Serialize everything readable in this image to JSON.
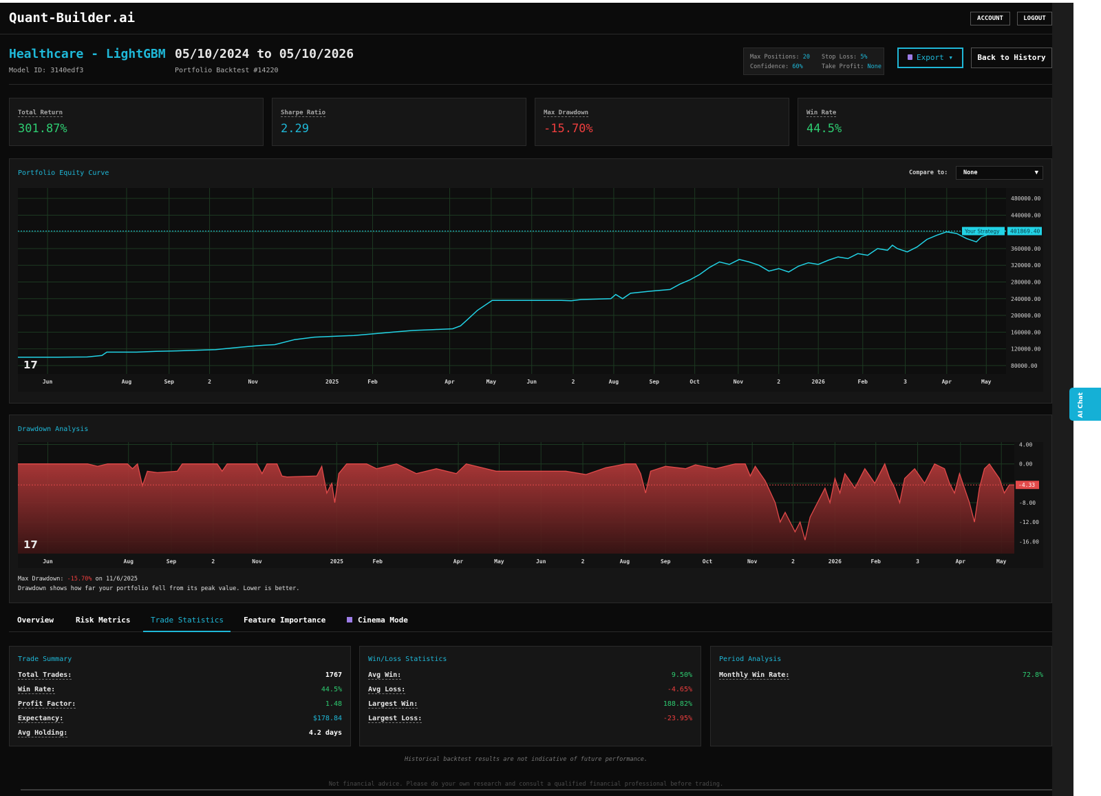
{
  "app": {
    "brand": "Quant-Builder.ai",
    "account_label": "ACCOUNT",
    "logout_label": "LOGOUT",
    "ai_chat_label": "AI Chat"
  },
  "header": {
    "title": "Healthcare - LightGBM",
    "model_id": "Model ID: 3140edf3",
    "date_range": "05/10/2024 to 05/10/2026",
    "backtest": "Portfolio Backtest #14220",
    "settings": {
      "max_positions_label": "Max Positions:",
      "max_positions_value": "20",
      "stop_loss_label": "Stop Loss:",
      "stop_loss_value": "5%",
      "confidence_label": "Confidence:",
      "confidence_value": "60%",
      "take_profit_label": "Take Profit:",
      "take_profit_value": "None"
    },
    "export_label": "Export ▾",
    "back_label": "Back to History"
  },
  "metrics": [
    {
      "label": "Total Return",
      "value": "301.87%",
      "color": "#2ecc71"
    },
    {
      "label": "Sharpe Ratio",
      "value": "2.29",
      "color": "#1fb8d8"
    },
    {
      "label": "Max Drawdown",
      "value": "-15.70%",
      "color": "#ef3e3e"
    },
    {
      "label": "Win Rate",
      "value": "44.5%",
      "color": "#2ecc71"
    }
  ],
  "equity_panel": {
    "title": "Portfolio Equity Curve",
    "compare_label": "Compare to:",
    "compare_value": "None",
    "logo": "17"
  },
  "drawdown_panel": {
    "title": "Drawdown Analysis",
    "max_label": "Max Drawdown:",
    "max_value": "-15.70%",
    "max_date": "on 11/6/2025",
    "note": "Drawdown shows how far your portfolio fell from its peak value. Lower is better.",
    "logo": "17"
  },
  "chart_data": [
    {
      "type": "line",
      "title": "Portfolio Equity Curve",
      "series": [
        {
          "name": "Your Strategy"
        }
      ],
      "y_ticks": [
        "480000.00",
        "440000.00",
        "400000.00",
        "360000.00",
        "320000.00",
        "280000.00",
        "240000.00",
        "200000.00",
        "160000.00",
        "120000.00",
        "80000.00"
      ],
      "ylim": [
        60000,
        505000
      ],
      "last_value": 401869.4,
      "last_value_label": "401869.40",
      "series_label": "Your Strategy",
      "x_ticks": [
        {
          "label": "Jun",
          "t": 0.03
        },
        {
          "label": "Aug",
          "t": 0.11
        },
        {
          "label": "Sep",
          "t": 0.153
        },
        {
          "label": "2",
          "t": 0.194
        },
        {
          "label": "Nov",
          "t": 0.238
        },
        {
          "label": "2025",
          "t": 0.318
        },
        {
          "label": "Feb",
          "t": 0.359
        },
        {
          "label": "Apr",
          "t": 0.437
        },
        {
          "label": "May",
          "t": 0.479
        },
        {
          "label": "Jun",
          "t": 0.52
        },
        {
          "label": "2",
          "t": 0.562
        },
        {
          "label": "Aug",
          "t": 0.603
        },
        {
          "label": "Sep",
          "t": 0.644
        },
        {
          "label": "Oct",
          "t": 0.685
        },
        {
          "label": "Nov",
          "t": 0.729
        },
        {
          "label": "2",
          "t": 0.77
        },
        {
          "label": "2026",
          "t": 0.81
        },
        {
          "label": "Feb",
          "t": 0.855
        },
        {
          "label": "3",
          "t": 0.898
        },
        {
          "label": "Apr",
          "t": 0.94
        },
        {
          "label": "May",
          "t": 0.98
        }
      ],
      "points": [
        [
          0.0,
          100000
        ],
        [
          0.04,
          100000
        ],
        [
          0.07,
          100500
        ],
        [
          0.085,
          104000
        ],
        [
          0.09,
          112000
        ],
        [
          0.12,
          112000
        ],
        [
          0.14,
          114000
        ],
        [
          0.16,
          115000
        ],
        [
          0.2,
          118000
        ],
        [
          0.225,
          124000
        ],
        [
          0.245,
          128000
        ],
        [
          0.26,
          130000
        ],
        [
          0.28,
          142000
        ],
        [
          0.3,
          148000
        ],
        [
          0.32,
          150000
        ],
        [
          0.34,
          152000
        ],
        [
          0.36,
          156000
        ],
        [
          0.38,
          160000
        ],
        [
          0.4,
          164000
        ],
        [
          0.42,
          166000
        ],
        [
          0.44,
          168000
        ],
        [
          0.448,
          175000
        ],
        [
          0.455,
          190000
        ],
        [
          0.465,
          212000
        ],
        [
          0.48,
          236000
        ],
        [
          0.55,
          236000
        ],
        [
          0.56,
          235000
        ],
        [
          0.57,
          238000
        ],
        [
          0.6,
          240000
        ],
        [
          0.605,
          250000
        ],
        [
          0.612,
          240000
        ],
        [
          0.62,
          253000
        ],
        [
          0.64,
          258000
        ],
        [
          0.66,
          262000
        ],
        [
          0.67,
          275000
        ],
        [
          0.68,
          285000
        ],
        [
          0.69,
          298000
        ],
        [
          0.7,
          315000
        ],
        [
          0.71,
          328000
        ],
        [
          0.72,
          322000
        ],
        [
          0.73,
          334000
        ],
        [
          0.74,
          328000
        ],
        [
          0.75,
          320000
        ],
        [
          0.76,
          306000
        ],
        [
          0.77,
          312000
        ],
        [
          0.78,
          304000
        ],
        [
          0.79,
          318000
        ],
        [
          0.8,
          326000
        ],
        [
          0.81,
          322000
        ],
        [
          0.82,
          332000
        ],
        [
          0.83,
          340000
        ],
        [
          0.84,
          336000
        ],
        [
          0.85,
          348000
        ],
        [
          0.86,
          344000
        ],
        [
          0.87,
          360000
        ],
        [
          0.88,
          356000
        ],
        [
          0.885,
          368000
        ],
        [
          0.89,
          360000
        ],
        [
          0.9,
          352000
        ],
        [
          0.91,
          364000
        ],
        [
          0.92,
          382000
        ],
        [
          0.93,
          392000
        ],
        [
          0.94,
          400000
        ],
        [
          0.95,
          396000
        ],
        [
          0.96,
          384000
        ],
        [
          0.97,
          376000
        ],
        [
          0.975,
          388000
        ],
        [
          0.98,
          392000
        ],
        [
          0.99,
          404000
        ],
        [
          1.0,
          401869
        ]
      ]
    },
    {
      "type": "area",
      "title": "Drawdown Analysis",
      "y_ticks": [
        "4.00",
        "0.00",
        "-4.00",
        "-8.00",
        "-12.00",
        "-16.00"
      ],
      "ylim": [
        -18.5,
        4.5
      ],
      "last_value": -4.33,
      "last_value_label": "-4.33",
      "x_ticks": [
        {
          "label": "Jun",
          "t": 0.03
        },
        {
          "label": "Aug",
          "t": 0.111
        },
        {
          "label": "Sep",
          "t": 0.154
        },
        {
          "label": "2",
          "t": 0.196
        },
        {
          "label": "Nov",
          "t": 0.24
        },
        {
          "label": "2025",
          "t": 0.32
        },
        {
          "label": "Feb",
          "t": 0.361
        },
        {
          "label": "Apr",
          "t": 0.442
        },
        {
          "label": "May",
          "t": 0.483
        },
        {
          "label": "Jun",
          "t": 0.525
        },
        {
          "label": "2",
          "t": 0.567
        },
        {
          "label": "Aug",
          "t": 0.609
        },
        {
          "label": "Sep",
          "t": 0.65
        },
        {
          "label": "Oct",
          "t": 0.692
        },
        {
          "label": "Nov",
          "t": 0.737
        },
        {
          "label": "2",
          "t": 0.778
        },
        {
          "label": "2026",
          "t": 0.82
        },
        {
          "label": "Feb",
          "t": 0.861
        },
        {
          "label": "3",
          "t": 0.903
        },
        {
          "label": "Apr",
          "t": 0.946
        },
        {
          "label": "May",
          "t": 0.987
        }
      ],
      "points": [
        [
          0.0,
          0
        ],
        [
          0.07,
          0
        ],
        [
          0.08,
          -0.5
        ],
        [
          0.09,
          0
        ],
        [
          0.11,
          0
        ],
        [
          0.115,
          -1
        ],
        [
          0.12,
          0
        ],
        [
          0.125,
          -4.5
        ],
        [
          0.13,
          -1.5
        ],
        [
          0.14,
          -1.8
        ],
        [
          0.16,
          -1.5
        ],
        [
          0.165,
          0
        ],
        [
          0.2,
          0
        ],
        [
          0.205,
          -1.5
        ],
        [
          0.21,
          0
        ],
        [
          0.24,
          0
        ],
        [
          0.245,
          -2
        ],
        [
          0.25,
          0
        ],
        [
          0.26,
          0
        ],
        [
          0.265,
          -2.5
        ],
        [
          0.27,
          -2.7
        ],
        [
          0.3,
          -2.5
        ],
        [
          0.305,
          -0.5
        ],
        [
          0.31,
          -6
        ],
        [
          0.315,
          -4
        ],
        [
          0.318,
          -8
        ],
        [
          0.322,
          -2
        ],
        [
          0.33,
          0
        ],
        [
          0.35,
          0
        ],
        [
          0.36,
          -1
        ],
        [
          0.38,
          0
        ],
        [
          0.4,
          -2
        ],
        [
          0.42,
          -1
        ],
        [
          0.44,
          -2
        ],
        [
          0.45,
          0
        ],
        [
          0.47,
          -1
        ],
        [
          0.48,
          -1.5
        ],
        [
          0.55,
          -1.5
        ],
        [
          0.57,
          -2.2
        ],
        [
          0.59,
          -0.8
        ],
        [
          0.61,
          0
        ],
        [
          0.62,
          0
        ],
        [
          0.625,
          -2
        ],
        [
          0.63,
          -6
        ],
        [
          0.635,
          -1.5
        ],
        [
          0.65,
          -0.5
        ],
        [
          0.67,
          -1
        ],
        [
          0.68,
          -0.2
        ],
        [
          0.7,
          -1
        ],
        [
          0.72,
          0
        ],
        [
          0.73,
          0
        ],
        [
          0.735,
          -2.5
        ],
        [
          0.74,
          -0.5
        ],
        [
          0.75,
          -3.5
        ],
        [
          0.76,
          -8
        ],
        [
          0.765,
          -12
        ],
        [
          0.77,
          -10
        ],
        [
          0.78,
          -14
        ],
        [
          0.785,
          -12
        ],
        [
          0.79,
          -15.7
        ],
        [
          0.795,
          -11
        ],
        [
          0.8,
          -9
        ],
        [
          0.81,
          -5
        ],
        [
          0.815,
          -8
        ],
        [
          0.82,
          -3
        ],
        [
          0.825,
          -6
        ],
        [
          0.83,
          -2
        ],
        [
          0.84,
          -5
        ],
        [
          0.85,
          -1
        ],
        [
          0.86,
          -4
        ],
        [
          0.87,
          0
        ],
        [
          0.875,
          -3
        ],
        [
          0.88,
          -5
        ],
        [
          0.885,
          -8
        ],
        [
          0.89,
          -3
        ],
        [
          0.9,
          -1
        ],
        [
          0.91,
          -4
        ],
        [
          0.92,
          0
        ],
        [
          0.93,
          -1
        ],
        [
          0.935,
          -4
        ],
        [
          0.94,
          -6
        ],
        [
          0.945,
          -2
        ],
        [
          0.95,
          -5
        ],
        [
          0.955,
          -8
        ],
        [
          0.96,
          -12
        ],
        [
          0.965,
          -5
        ],
        [
          0.97,
          -1
        ],
        [
          0.975,
          0
        ],
        [
          0.98,
          -1.5
        ],
        [
          0.985,
          -3
        ],
        [
          0.99,
          -6
        ],
        [
          0.995,
          -4.33
        ],
        [
          1.0,
          -4.33
        ]
      ]
    }
  ],
  "tabs": [
    {
      "label": "Overview",
      "active": false
    },
    {
      "label": "Risk Metrics",
      "active": false
    },
    {
      "label": "Trade Statistics",
      "active": true
    },
    {
      "label": "Feature Importance",
      "active": false
    },
    {
      "label": "Cinema Mode",
      "active": false,
      "icon": "clapper-icon"
    }
  ],
  "trade_summary": {
    "title": "Trade Summary",
    "rows": [
      {
        "label": "Total Trades:",
        "value": "1767",
        "color": "#ffffff"
      },
      {
        "label": "Win Rate:",
        "value": "44.5%",
        "color": "#2ecc71"
      },
      {
        "label": "Profit Factor:",
        "value": "1.48",
        "color": "#2ecc71"
      },
      {
        "label": "Expectancy:",
        "value": "$178.84",
        "color": "#1fb8d8"
      },
      {
        "label": "Avg Holding:",
        "value": "4.2 days",
        "color": "#ffffff"
      }
    ]
  },
  "win_loss": {
    "title": "Win/Loss Statistics",
    "rows": [
      {
        "label": "Avg Win:",
        "value": "9.50%",
        "color": "#2ecc71"
      },
      {
        "label": "Avg Loss:",
        "value": "-4.65%",
        "color": "#ef3e3e"
      },
      {
        "label": "Largest Win:",
        "value": "188.82%",
        "color": "#2ecc71"
      },
      {
        "label": "Largest Loss:",
        "value": "-23.95%",
        "color": "#ef3e3e"
      }
    ]
  },
  "period": {
    "title": "Period Analysis",
    "rows": [
      {
        "label": "Monthly Win Rate:",
        "value": "72.8%",
        "color": "#2ecc71"
      }
    ]
  },
  "footer": {
    "disclaimer": "Historical backtest results are not indicative of future performance.",
    "advice": "Not financial advice. Please do your own research and consult a qualified financial professional before trading."
  }
}
